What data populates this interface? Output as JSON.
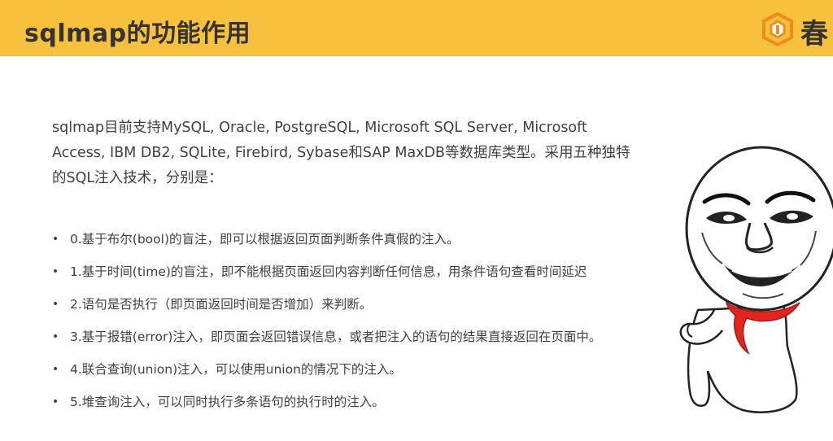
{
  "header": {
    "title": "sqlmap的功能作用",
    "brand_char": "春",
    "logo_icon": "orange-hexagon-logo-icon",
    "bg_color": "#f7c13d"
  },
  "intro": {
    "lines": [
      "sqlmap目前支持MySQL, Oracle, PostgreSQL, Microsoft SQL Server, Microsoft",
      "Access, IBM DB2, SQLite, Firebird, Sybase和SAP MaxDB等数据库类型。采用五种独特",
      "的SQL注入技术，分别是："
    ]
  },
  "bullets": [
    "0.基于布尔(bool)的盲注，即可以根据返回页面判断条件真假的注入。",
    "1.基于时间(time)的盲注，即不能根据页面返回内容判断任何信息，用条件语句查看时间延迟",
    "2.语句是否执行（即页面返回时间是否增加）来判断。",
    "3.基于报错(error)注入，即页面会返回错误信息，或者把注入的语句的结果直接返回在页面中。",
    "4.联合查询(union)注入，可以使用union的情况下的注入。",
    "5.堆查询注入，可以同时执行多条语句的执行时的注入。"
  ],
  "bullet_symbol": "•",
  "illustration": "meme-face-leaning-figure"
}
